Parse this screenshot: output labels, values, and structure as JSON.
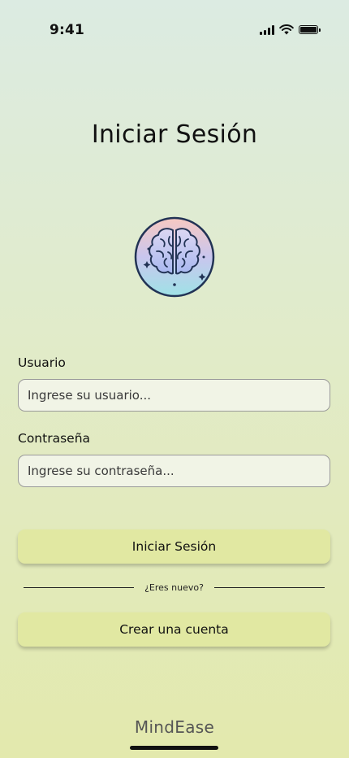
{
  "status_bar": {
    "time": "9:41",
    "icons": [
      "cellular-signal-icon",
      "wifi-icon",
      "battery-icon"
    ]
  },
  "title": "Iniciar Sesión",
  "logo": {
    "icon": "brain-icon",
    "colors": [
      "#f7c9c2",
      "#c9c6ee",
      "#9fe2e6"
    ]
  },
  "form": {
    "username": {
      "label": "Usuario",
      "placeholder": "Ingrese su usuario...",
      "value": ""
    },
    "password": {
      "label": "Contraseña",
      "placeholder": "Ingrese su contraseña...",
      "value": ""
    },
    "login_button": "Iniciar Sesión",
    "divider_text": "¿Eres nuevo?",
    "signup_button": "Crear una cuenta"
  },
  "footer": {
    "app_name": "MindEase"
  },
  "colors": {
    "button_bg": "#e1e8a2",
    "input_bg": "#f1f4e6",
    "background_top": "#dcebe2",
    "background_bottom": "#e3e9ad"
  }
}
